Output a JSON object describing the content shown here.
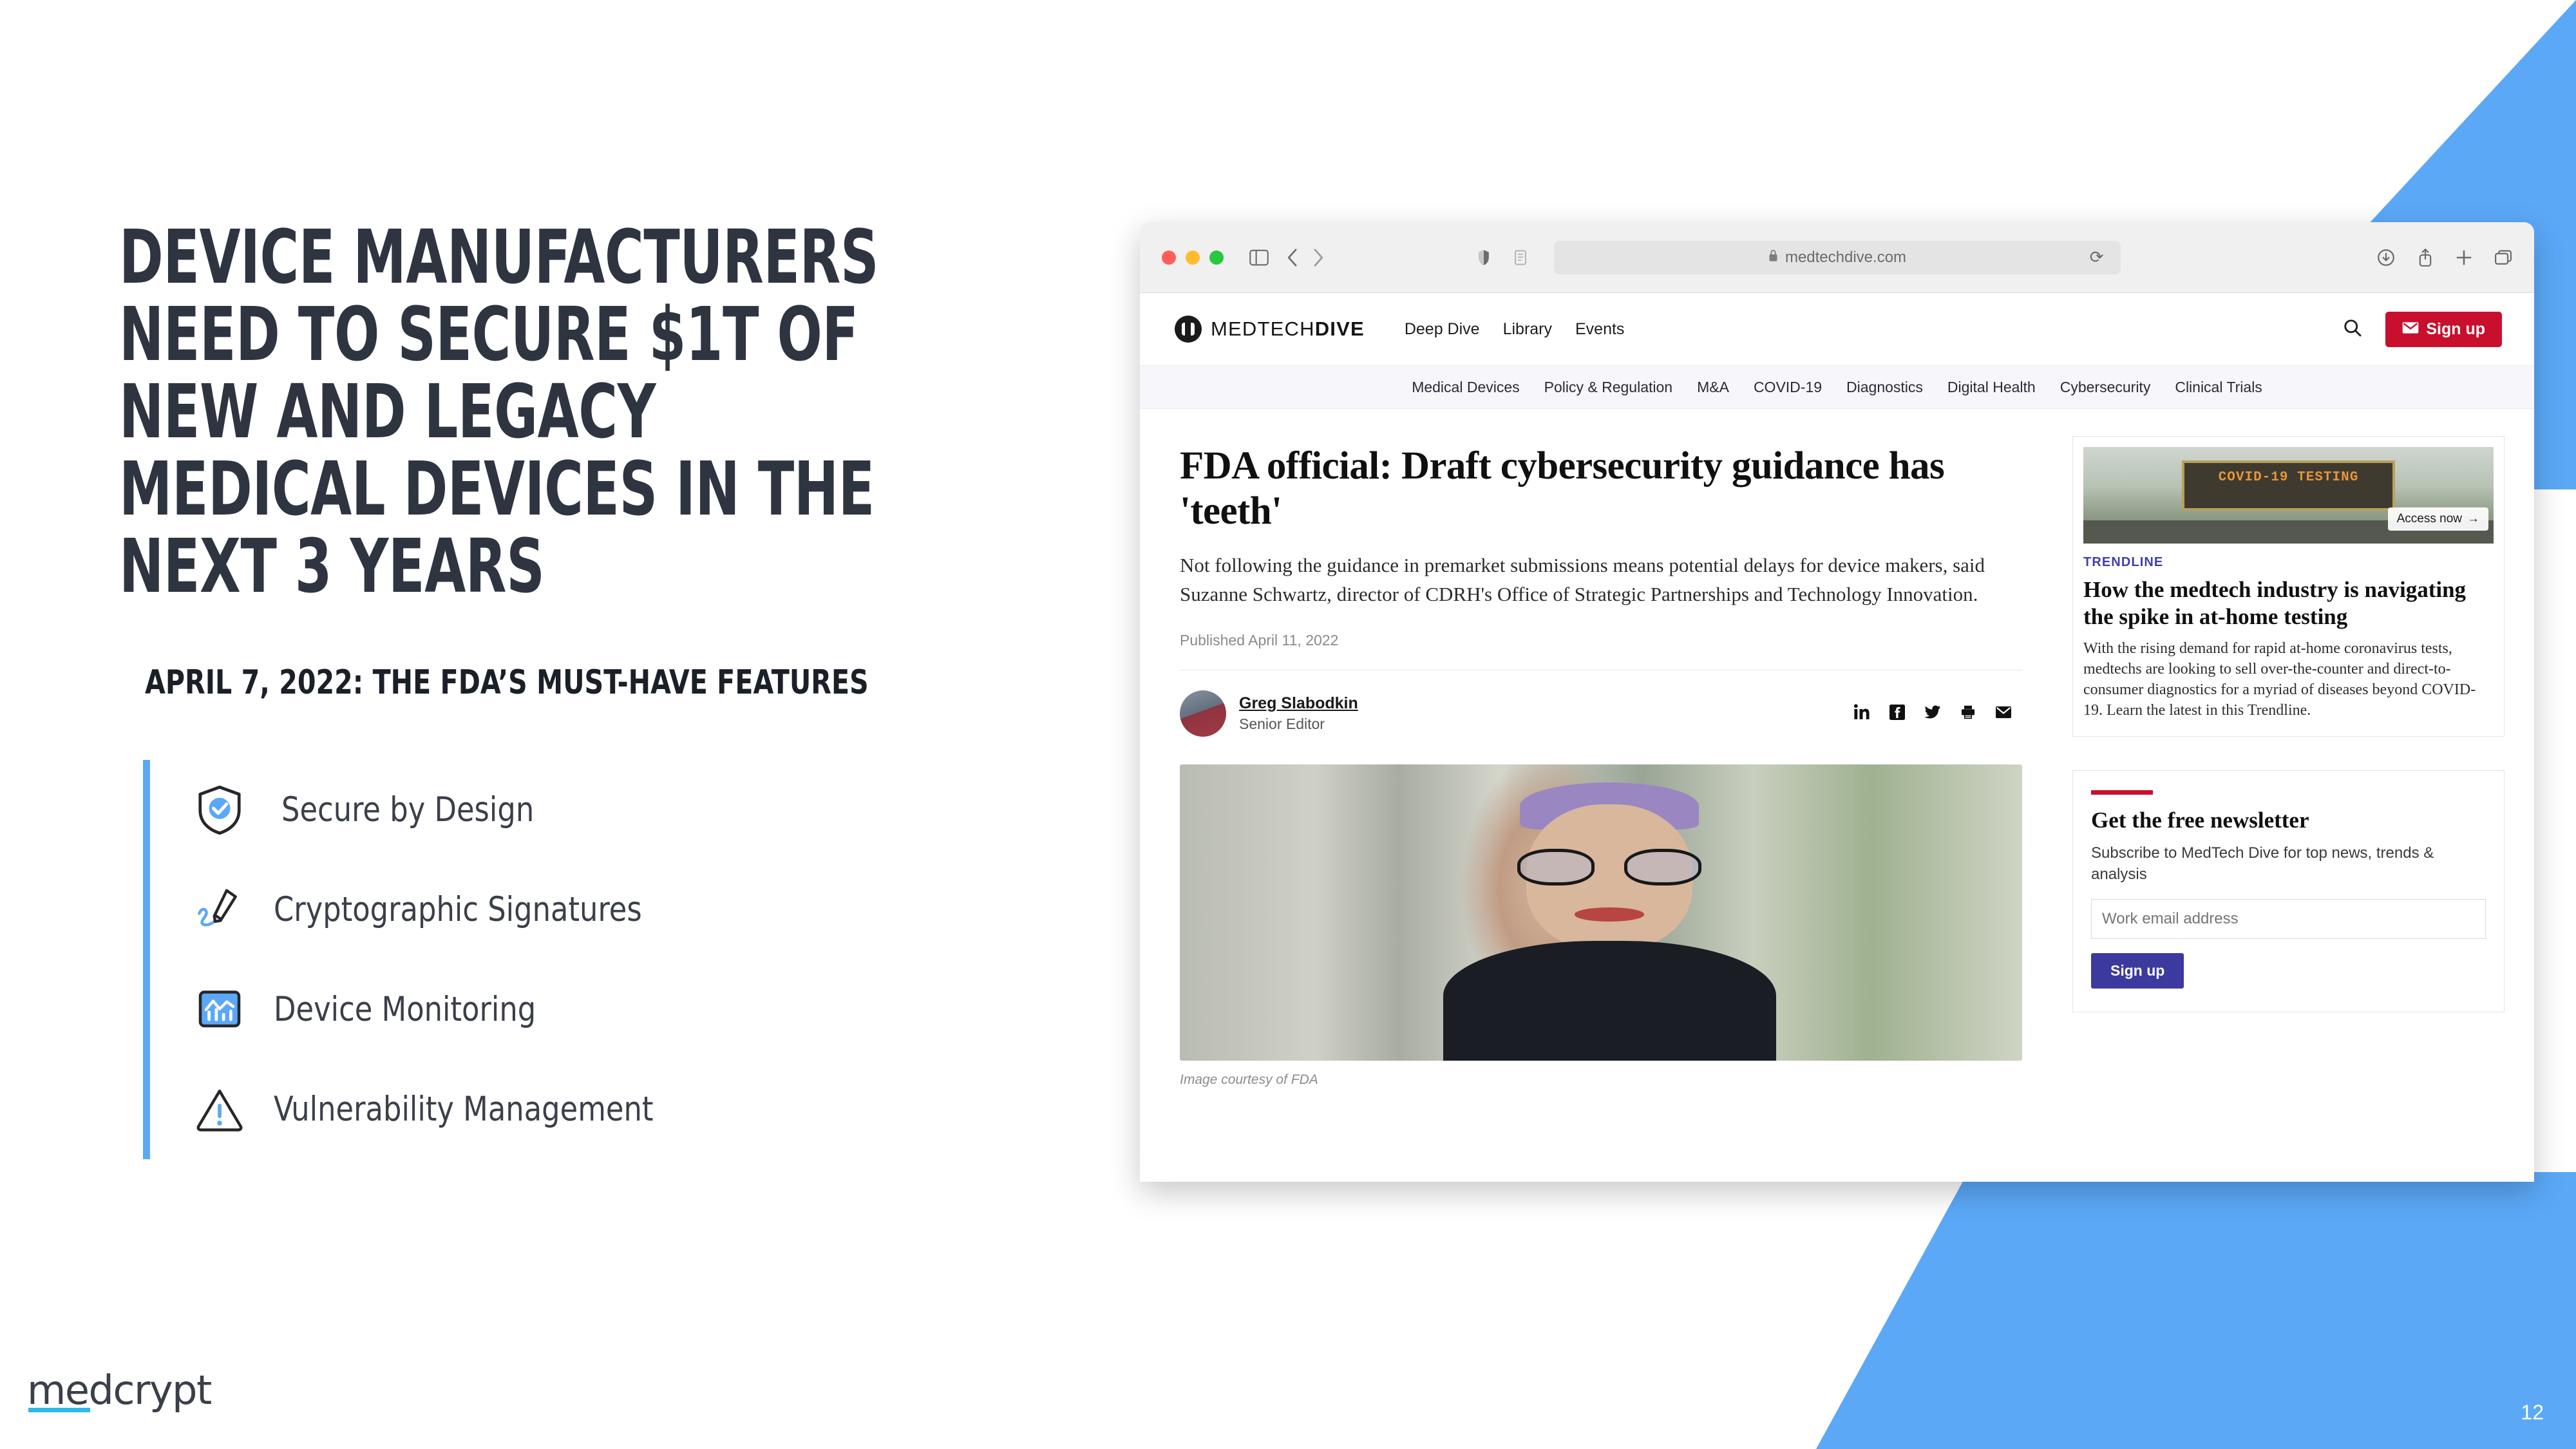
{
  "slide": {
    "title": "DEVICE MANUFACTURERS NEED TO SECURE $1T OF NEW AND LEGACY MEDICAL DEVICES IN THE NEXT 3 YEARS",
    "subtitle": "APRIL 7, 2022: THE FDA’S MUST-HAVE FEATURES",
    "page_number": "12",
    "accent_color": "#5ba8f7",
    "title_color": "#2e3440",
    "features": [
      {
        "label": "Secure by Design",
        "icon": "shield-check-icon"
      },
      {
        "label": "Cryptographic Signatures",
        "icon": "signature-pen-icon"
      },
      {
        "label": "Device Monitoring",
        "icon": "chart-monitor-icon"
      },
      {
        "label": "Vulnerability Management",
        "icon": "warning-triangle-icon"
      }
    ]
  },
  "brand": {
    "name_prefix": "med",
    "name_suffix": "crypt",
    "underline_color": "#2bb8ec"
  },
  "browser": {
    "traffic_lights": [
      "close-red",
      "minimize-yellow",
      "maximize-green"
    ],
    "url": "medtechdive.com",
    "lock_icon": "padlock-icon",
    "reload_icon": "reload-icon",
    "sidebar_icon": "sidebar-toggle-icon",
    "back_icon": "chevron-left-icon",
    "forward_icon": "chevron-right-icon",
    "right_icons": [
      "downloads-icon",
      "share-icon",
      "new-tab-icon",
      "tab-overview-icon"
    ]
  },
  "site": {
    "logo_text_regular": "MEDTECH",
    "logo_text_bold": "DIVE",
    "primary_nav": [
      "Deep Dive",
      "Library",
      "Events"
    ],
    "search_icon": "search-icon",
    "signup_label": "Sign up",
    "signup_icon": "envelope-icon",
    "signup_color": "#c8102e",
    "secondary_nav": [
      "Medical Devices",
      "Policy & Regulation",
      "M&A",
      "COVID-19",
      "Diagnostics",
      "Digital Health",
      "Cybersecurity",
      "Clinical Trials"
    ]
  },
  "article": {
    "headline": "FDA official: Draft cybersecurity guidance has 'teeth'",
    "deck": "Not following the guidance in premarket submissions means potential delays for device makers, said Suzanne Schwartz, director of CDRH's Office of Strategic Partnerships and Technology Innovation.",
    "published": "Published April 11, 2022",
    "author_name": "Greg Slabodkin",
    "author_role": "Senior Editor",
    "share_icons": [
      "linkedin-icon",
      "facebook-icon",
      "twitter-icon",
      "print-icon",
      "email-icon"
    ],
    "photo_caption": "Image courtesy of FDA"
  },
  "sidebar": {
    "trendline": {
      "image_sign_text": "COVID-19 TESTING",
      "access_label": "Access now",
      "access_arrow": "arrow-right-icon",
      "kicker": "TRENDLINE",
      "title": "How the medtech industry is navigating the spike in at-home testing",
      "body": "With the rising demand for rapid at-home coronavirus tests, medtechs are looking to sell over-the-counter and direct-to-consumer diagnostics for a myriad of diseases beyond COVID-19. Learn the latest in this Trendline."
    },
    "newsletter": {
      "rule_color": "#c8102e",
      "title": "Get the free newsletter",
      "subtitle": "Subscribe to MedTech Dive for top news, trends & analysis",
      "input_placeholder": "Work email address",
      "submit_label": "Sign up",
      "submit_color": "#3c3a9e"
    }
  }
}
